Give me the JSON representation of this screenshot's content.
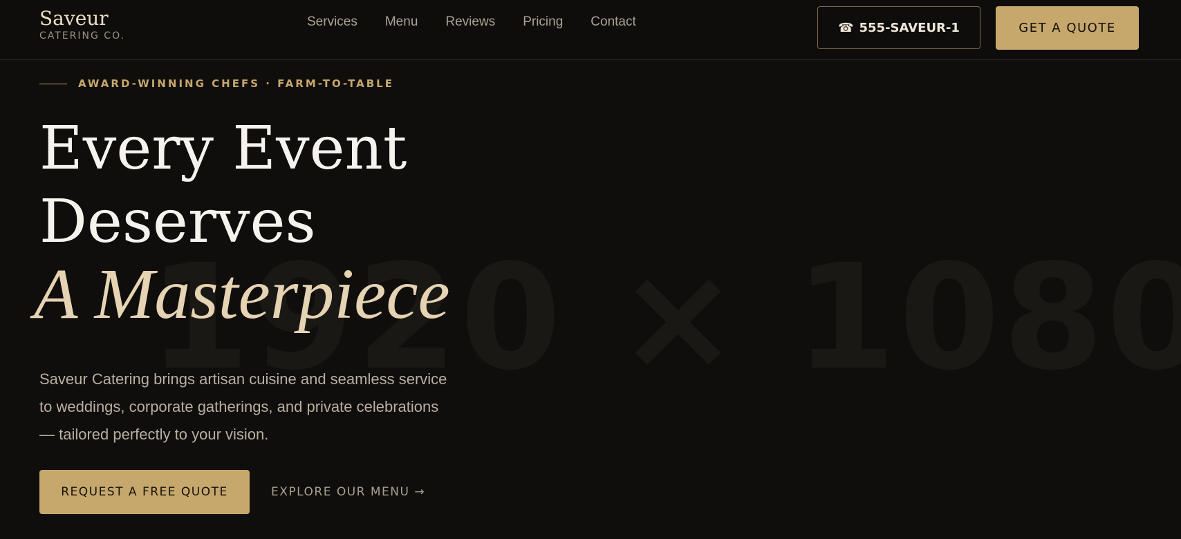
{
  "background_placeholder": "1920 × 1080",
  "brand": {
    "name": "Saveur",
    "tagline": "CATERING CO."
  },
  "nav": {
    "items": [
      {
        "label": "Services"
      },
      {
        "label": "Menu"
      },
      {
        "label": "Reviews"
      },
      {
        "label": "Pricing"
      },
      {
        "label": "Contact"
      }
    ]
  },
  "header_actions": {
    "phone_icon": "phone-icon",
    "phone_label": "555-SAVEUR-1",
    "quote_label": "GET A QUOTE"
  },
  "hero": {
    "eyebrow": "AWARD-WINNING CHEFS · FARM-TO-TABLE",
    "headline_line1": "Every Event",
    "headline_line2": "Deserves",
    "headline_accent": "A Masterpiece",
    "description": "Saveur Catering brings artisan cuisine and seamless service to weddings, corporate gatherings, and private celebrations — tailored perfectly to your vision.",
    "cta_primary": "REQUEST A FREE QUOTE",
    "cta_secondary": "EXPLORE OUR MENU →"
  },
  "colors": {
    "background": "#100e0c",
    "accent_gold": "#c6a76c",
    "accent_cream": "#e6d3b3",
    "text_primary": "#f6f3ee",
    "text_muted": "#b8afa1"
  }
}
